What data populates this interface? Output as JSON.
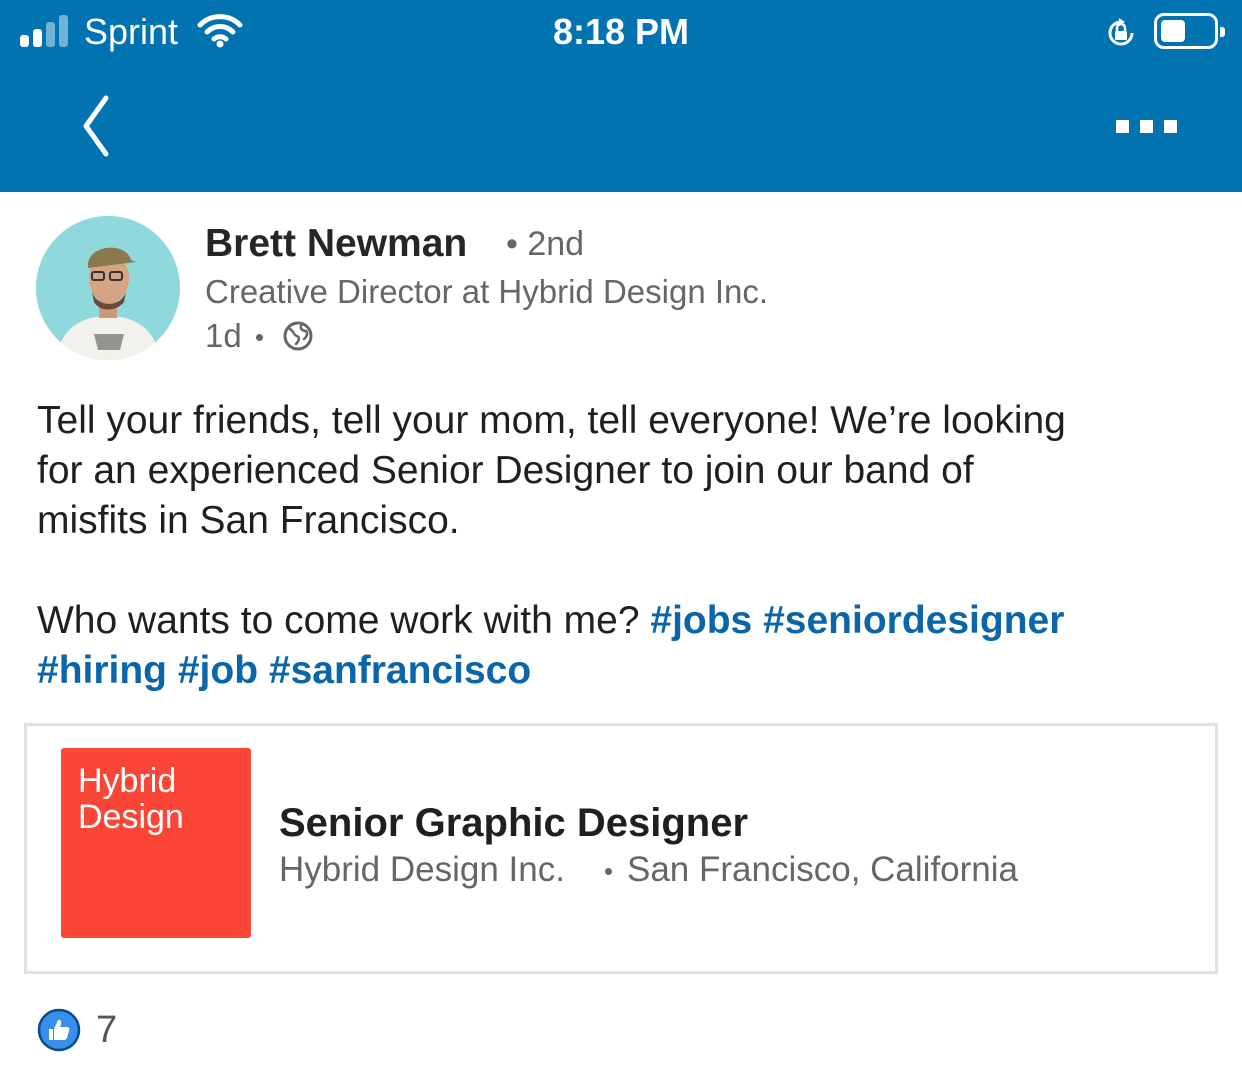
{
  "status_bar": {
    "carrier": "Sprint",
    "time": "8:18 PM",
    "icons": [
      "signal-icon",
      "wifi-icon",
      "rotation-lock-icon",
      "battery-icon"
    ]
  },
  "nav": {
    "back_icon": "chevron-left-icon",
    "more_icon": "more-options-icon"
  },
  "post": {
    "author": {
      "name": "Brett Newman",
      "degree": "2nd",
      "headline": "Creative Director at Hybrid Design Inc.",
      "time": "1d",
      "visibility_icon": "globe-icon"
    },
    "text_line1": "Tell your friends, tell your mom, tell everyone! We’re looking",
    "text_line2": "for an experienced Senior Designer to join our band of",
    "text_line3": "misfits in San Francisco.",
    "text_line4": "Who wants to come work with me?",
    "hashtags": [
      "#jobs",
      "#seniordesigner",
      "#hiring",
      "#job",
      "#sanfrancisco"
    ]
  },
  "job_card": {
    "logo_line1": "Hybrid",
    "logo_line2": "Design",
    "title": "Senior Graphic Designer",
    "company": "Hybrid Design Inc.",
    "location": "San Francisco, California"
  },
  "reactions": {
    "icon": "like-icon",
    "count": "7"
  },
  "colors": {
    "brand_blue": "#0173b1",
    "hashtag": "#0a66a8",
    "logo_red": "#fb4637",
    "secondary_text": "#666666"
  }
}
